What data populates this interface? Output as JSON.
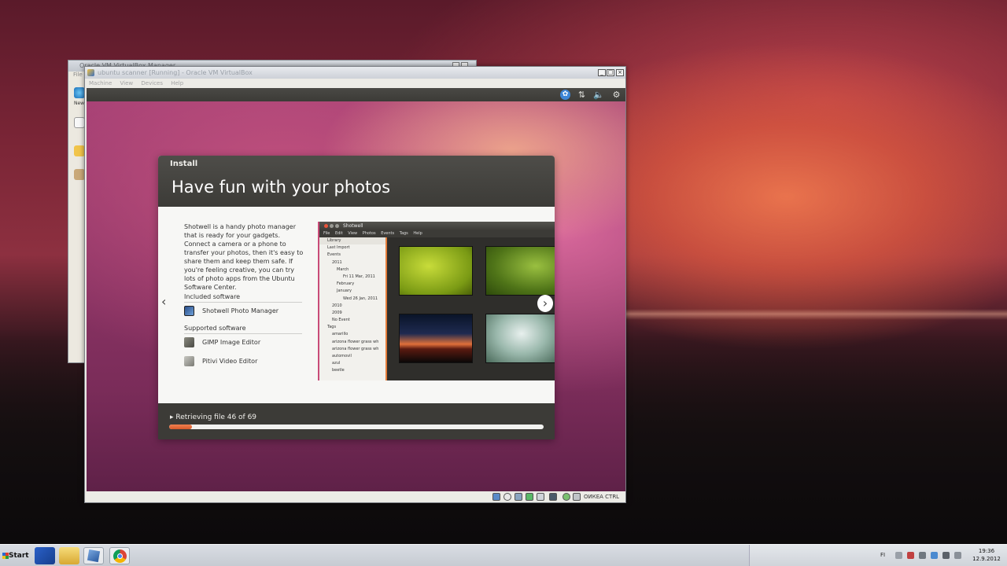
{
  "desktop": {
    "manager_window_title": "Oracle VM VirtualBox Manager",
    "manager_menu": [
      "File"
    ],
    "manager_toolbar_label": "New"
  },
  "vm_window": {
    "title": "ubuntu scanner [Running] - Oracle VM VirtualBox",
    "menu": [
      "Machine",
      "View",
      "Devices",
      "Help"
    ],
    "host_key_label": "ОИКЕА CTRL"
  },
  "installer": {
    "header_label": "Install",
    "heading": "Have fun with your photos",
    "description": "Shotwell is a handy photo manager that is ready for your gadgets. Connect a camera or a phone to transfer your photos, then it's easy to share them and keep them safe. If you're feeling creative, you can try lots of photo apps from the Ubuntu Software Center.",
    "included_heading": "Included software",
    "included": [
      {
        "icon": "shotwell-icon",
        "label": "Shotwell Photo Manager"
      }
    ],
    "supported_heading": "Supported software",
    "supported": [
      {
        "icon": "gimp-icon",
        "label": "GIMP Image Editor"
      },
      {
        "icon": "pitivi-icon",
        "label": "Pitivi Video Editor"
      }
    ],
    "progress_label": "Retrieving file 46 of 69",
    "progress_fraction": 0.06,
    "prev_arrow": "‹",
    "next_arrow": "›"
  },
  "shotwell_preview": {
    "title": "Shotwell",
    "menu": [
      "File",
      "Edit",
      "View",
      "Photos",
      "Events",
      "Tags",
      "Help"
    ],
    "sidebar": [
      "Library",
      "Last Import",
      "Events",
      "2011",
      "March",
      "Fri 11 Mar, 2011",
      "February",
      "January",
      "Wed 26 Jan, 2011",
      "2010",
      "2009",
      "No Event",
      "Tags",
      "amarillo",
      "arizona flower grass wh",
      "arizona flower grass wh",
      "automovil",
      "azul",
      "beetle"
    ]
  },
  "taskbar": {
    "start_label": "Start",
    "language": "FI",
    "time": "19:36",
    "date": "12.9.2012"
  },
  "colors": {
    "ubuntu_orange": "#dd5a2a",
    "ubuntu_panel": "#3c3b37",
    "accessibility_blue": "#3d86d6"
  }
}
